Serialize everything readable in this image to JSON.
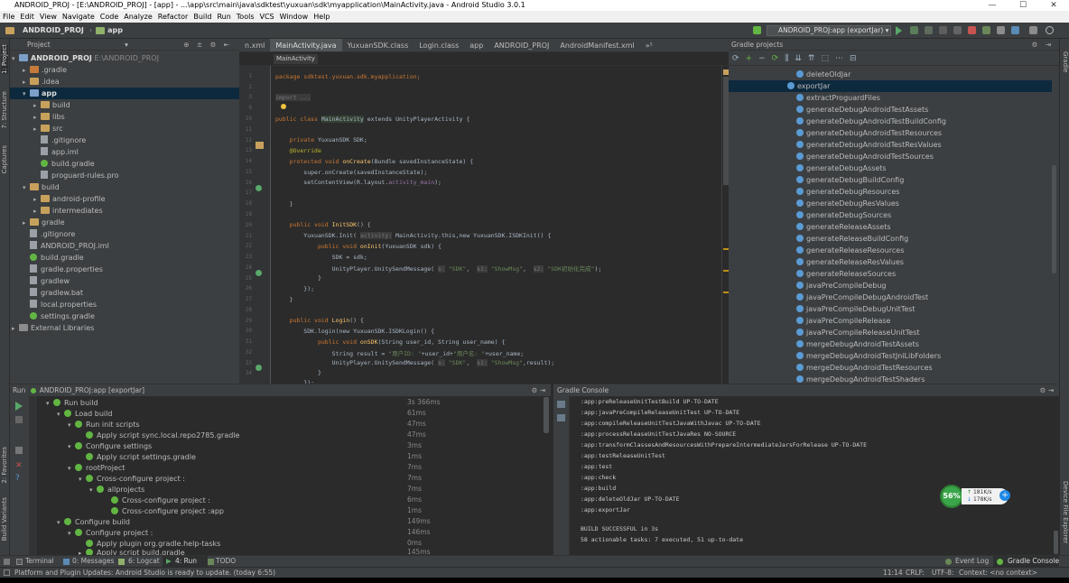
{
  "window": {
    "title": "ANDROID_PROJ - [E:\\ANDROID_PROJ] - [app] - ...\\app\\src\\main\\java\\sdktest\\yuxuan\\sdk\\myapplication\\MainActivity.java - Android Studio 3.0.1"
  },
  "menu": [
    "File",
    "Edit",
    "View",
    "Navigate",
    "Code",
    "Analyze",
    "Refactor",
    "Build",
    "Run",
    "Tools",
    "VCS",
    "Window",
    "Help"
  ],
  "toolbar": {
    "crumb1": "ANDROID_PROJ",
    "crumb2": "app",
    "run_config": "ANDROID_PROJ:app (exportJar)"
  },
  "project": {
    "header": "Project",
    "root": "ANDROID_PROJ",
    "root_path": "E:\\ANDROID_PROJ",
    "items": [
      ".gradle",
      ".idea",
      "app",
      "build",
      "libs",
      "src",
      ".gitignore",
      "app.iml",
      "build.gradle",
      "proguard-rules.pro",
      "build",
      "android-profile",
      "intermediates",
      "gradle",
      ".gitignore",
      "ANDROID_PROJ.iml",
      "build.gradle",
      "gradle.properties",
      "gradlew",
      "gradlew.bat",
      "local.properties",
      "settings.gradle",
      "External Libraries"
    ]
  },
  "editor": {
    "tabs": [
      "n.xml",
      "MainActivity.java",
      "YuxuanSDK.class",
      "Login.class",
      "app",
      "ANDROID_PROJ",
      "AndroidManifest.xml"
    ],
    "tab_more": "»⁵",
    "breadcrumb": "MainActivity",
    "lines": {
      "l1": "package sdktest.yuxuan.sdk.myapplication;",
      "l3": "import ...",
      "l10a": "public class ",
      "l10b": "MainActivity",
      "l10c": " extends UnityPlayerActivity {",
      "l12a": "    private ",
      "l12b": "YuxuanSDK SDK;",
      "l13": "    @Override",
      "l14a": "    protected void ",
      "l14b": "onCreate",
      "l14c": "(Bundle savedInstanceState) {",
      "l15": "        super.onCreate(savedInstanceState);",
      "l16a": "        setContentView(R.layout.",
      "l16b": "activity_main",
      "l16c": ");",
      "l18": "    }",
      "l20a": "    public void ",
      "l20b": "InitSDK",
      "l20c": "() {",
      "l21a": "        YuxuanSDK.Init( ",
      "l21h": "activity:",
      "l21b": " MainActivity.this,new YuxuanSDK.ISDKInit() {",
      "l22a": "            public void ",
      "l22b": "onInit",
      "l22c": "(YuxuanSDK sdk) {",
      "l23": "                SDK = sdk;",
      "l24a": "                UnityPlayer.UnitySendMessage( ",
      "l24h1": "s:",
      "l24s1": " \"SDK\"",
      "l24m": ",  ",
      "l24h2": "s1:",
      "l24s2": " \"ShowMsg\"",
      "l24m2": ",  ",
      "l24h3": "s2:",
      "l24s3": " \"SDK初始化完成\"",
      "l24e": ");",
      "l25": "            }",
      "l26": "        });",
      "l27": "    }",
      "l29a": "    public void ",
      "l29b": "Login",
      "l29c": "() {",
      "l30": "        SDK.login(new YuxuanSDK.ISDKLogin() {",
      "l31a": "            public void ",
      "l31b": "onSDK",
      "l31c": "(String user_id, String user_name) {",
      "l32a": "                String result = ",
      "l32s": "\"用户ID: \"",
      "l32b": "+user_id+",
      "l32s2": "\"用户名: \"",
      "l32c": "+user_name;",
      "l33a": "                UnityPlayer.UnitySendMessage( ",
      "l33h1": "s:",
      "l33s1": " \"SDK\"",
      "l33m": ",  ",
      "l33h2": "s1:",
      "l33s2": " \"ShowMsg\"",
      "l33e": ",result);",
      "l34": "            }",
      "l35": "        });"
    },
    "line_numbers": [
      "1",
      "2",
      "3",
      "9",
      "10",
      "11",
      "12",
      "13",
      "14",
      "15",
      "16",
      "17",
      "18",
      "19",
      "20",
      "21",
      "22",
      "23",
      "24",
      "25",
      "26",
      "27",
      "28",
      "29",
      "30",
      "31",
      "32",
      "33",
      "34"
    ]
  },
  "gradle": {
    "header": "Gradle projects",
    "tasks": [
      "deleteOldJar",
      "exportJar",
      "extractProguardFiles",
      "generateDebugAndroidTestAssets",
      "generateDebugAndroidTestBuildConfig",
      "generateDebugAndroidTestResources",
      "generateDebugAndroidTestResValues",
      "generateDebugAndroidTestSources",
      "generateDebugAssets",
      "generateDebugBuildConfig",
      "generateDebugResources",
      "generateDebugResValues",
      "generateDebugSources",
      "generateReleaseAssets",
      "generateReleaseBuildConfig",
      "generateReleaseResources",
      "generateReleaseResValues",
      "generateReleaseSources",
      "javaPreCompileDebug",
      "javaPreCompileDebugAndroidTest",
      "javaPreCompileDebugUnitTest",
      "javaPreCompileRelease",
      "javaPreCompileReleaseUnitTest",
      "mergeDebugAndroidTestAssets",
      "mergeDebugAndroidTestJniLibFolders",
      "mergeDebugAndroidTestResources",
      "mergeDebugAndroidTestShaders"
    ],
    "selected": "exportJar"
  },
  "run": {
    "header": "Run",
    "config": "ANDROID_PROJ:app [exportJar]",
    "rows": [
      {
        "label": "Run build",
        "time": "3s 366ms",
        "indent": 0
      },
      {
        "label": "Load build",
        "time": "61ms",
        "indent": 1
      },
      {
        "label": "Run init scripts",
        "time": "47ms",
        "indent": 2
      },
      {
        "label": "Apply script sync.local.repo2785.gradle",
        "time": "47ms",
        "indent": 3
      },
      {
        "label": "Configure settings",
        "time": "3ms",
        "indent": 2
      },
      {
        "label": "Apply script settings.gradle",
        "time": "1ms",
        "indent": 3
      },
      {
        "label": "rootProject",
        "time": "7ms",
        "indent": 2
      },
      {
        "label": "Cross-configure project :",
        "time": "7ms",
        "indent": 3
      },
      {
        "label": "allprojects",
        "time": "7ms",
        "indent": 4
      },
      {
        "label": "Cross-configure project :",
        "time": "6ms",
        "indent": 5
      },
      {
        "label": "Cross-configure project :app",
        "time": "1ms",
        "indent": 5
      },
      {
        "label": "Configure build",
        "time": "149ms",
        "indent": 1
      },
      {
        "label": "Configure project :",
        "time": "146ms",
        "indent": 2
      },
      {
        "label": "Apply plugin org.gradle.help-tasks",
        "time": "0ms",
        "indent": 3
      },
      {
        "label": "Apply script build.gradle",
        "time": "145ms",
        "indent": 3
      }
    ]
  },
  "console": {
    "header": "Gradle Console",
    "lines": [
      ":app:preReleaseUnitTestBuild UP-TO-DATE",
      ":app:javaPreCompileReleaseUnitTest UP-TO-DATE",
      ":app:compileReleaseUnitTestJavaWithJavac UP-TO-DATE",
      ":app:processReleaseUnitTestJavaRes NO-SOURCE",
      ":app:transformClassesAndResourcesWithPrepareIntermediateJarsForRelease UP-TO-DATE",
      ":app:testReleaseUnitTest",
      ":app:test",
      ":app:check",
      ":app:build",
      ":app:deleteOldJar UP-TO-DATE",
      ":app:exportJar",
      "",
      "BUILD SUCCESSFUL in 3s",
      "58 actionable tasks: 7 executed, 51 up-to-date"
    ]
  },
  "network": {
    "percent": "56%",
    "up": "181K/s",
    "down": "178K/s"
  },
  "bottom_tabs": {
    "terminal": "Terminal",
    "messages": "0: Messages",
    "logcat": "6: Logcat",
    "run": "4: Run",
    "todo": "TODO",
    "event_log": "Event Log",
    "gradle_console": "Gradle Console"
  },
  "left_tabs": [
    "1: Project",
    "7: Structure",
    "Captures",
    "2: Favorites",
    "Build Variants"
  ],
  "right_tabs": [
    "Gradle",
    "Device File Explorer"
  ],
  "status": {
    "message": "Platform and Plugin Updates: Android Studio is ready to update. (today 6:55)",
    "position": "11:14",
    "line_sep": "CRLF:",
    "encoding": "UTF-8:",
    "context": "Context: <no context>"
  }
}
